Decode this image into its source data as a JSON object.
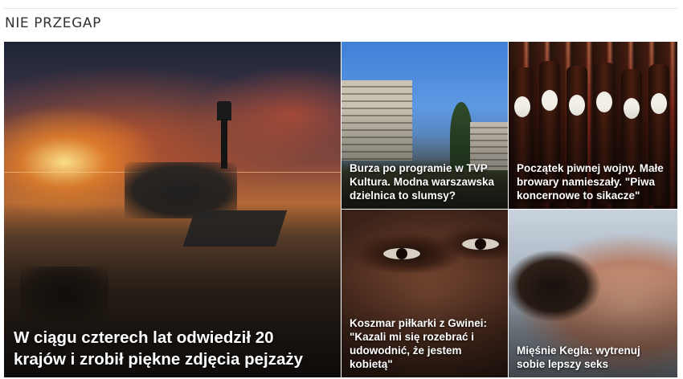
{
  "section": {
    "title": "NIE PRZEGAP"
  },
  "tiles": [
    {
      "id": "main",
      "title": "W ciągu czterech lat odwiedził 20 krajów i zrobił piękne zdjęcia pejzaży",
      "image_icon": "sunset-lighthouse-photo"
    },
    {
      "id": "burza",
      "title": "Burza po programie w TVP Kultura. Modna warszawska dzielnica to slumsy?",
      "image_icon": "city-blocks-photo"
    },
    {
      "id": "piwo",
      "title": "Początek piwnej wojny. Małe browary namieszały. \"Piwa koncernowe to sikacze\"",
      "image_icon": "beer-bottles-photo"
    },
    {
      "id": "koszmar",
      "title": "Koszmar piłkarki z Gwinei: \"Kazali mi się rozebrać i udowodnić, że jestem kobietą\"",
      "image_icon": "face-closeup-photo"
    },
    {
      "id": "kegla",
      "title": "Mięśnie Kegla: wytrenuj sobie lepszy seks",
      "image_icon": "couple-photo"
    }
  ],
  "colors": {
    "title_text": "#333333",
    "tile_text": "#ffffff",
    "divider": "#e6e6e6"
  }
}
